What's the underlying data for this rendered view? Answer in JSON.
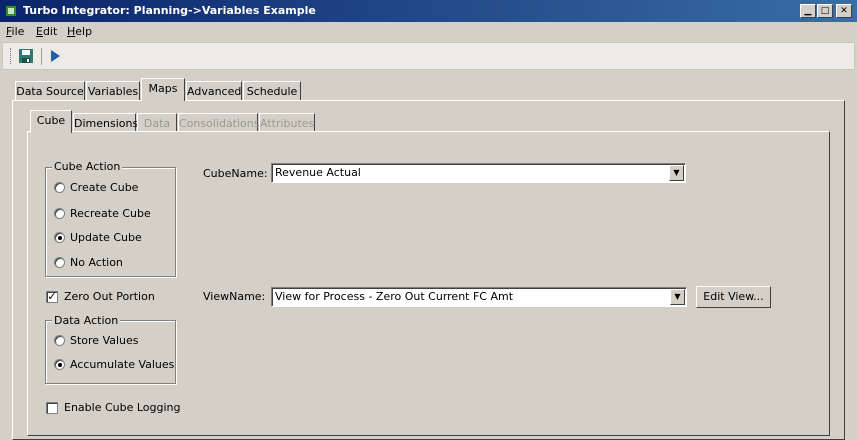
{
  "window": {
    "title": "Turbo Integrator:  Planning->Variables Example",
    "controls": {
      "minimize": "▁",
      "maximize": "□",
      "close": "✕"
    }
  },
  "menu": {
    "items": [
      {
        "label": "File",
        "accel": "F",
        "rest": "ile"
      },
      {
        "label": "Edit",
        "accel": "E",
        "rest": "dit"
      },
      {
        "label": "Help",
        "accel": "H",
        "rest": "elp"
      }
    ]
  },
  "toolbar": {
    "icons": [
      "save-icon",
      "run-icon"
    ]
  },
  "main_tabs": {
    "items": [
      "Data Source",
      "Variables",
      "Maps",
      "Advanced",
      "Schedule"
    ],
    "active": "Maps"
  },
  "sub_tabs": {
    "items": [
      "Cube",
      "Dimensions",
      "Data",
      "Consolidations",
      "Attributes"
    ],
    "active": "Cube",
    "disabled": [
      "Data",
      "Consolidations",
      "Attributes"
    ]
  },
  "cube_action": {
    "legend": "Cube Action",
    "options": [
      "Create Cube",
      "Recreate Cube",
      "Update Cube",
      "No Action"
    ],
    "selected": "Update Cube"
  },
  "cube_name": {
    "label": "CubeName:",
    "value": "Revenue Actual"
  },
  "zero_out": {
    "label": "Zero Out Portion",
    "checked": true,
    "mark": "✓"
  },
  "view_name": {
    "label": "ViewName:",
    "value": "View for Process - Zero Out Current FC Amt",
    "edit_button": "Edit View..."
  },
  "data_action": {
    "legend": "Data Action",
    "options": [
      "Store Values",
      "Accumulate Values"
    ],
    "selected": "Accumulate Values"
  },
  "cube_logging": {
    "label": "Enable Cube Logging",
    "checked": false
  },
  "colors": {
    "title_start": "#0a246a",
    "title_end": "#3a6ea5",
    "face": "#d4d0c8"
  }
}
